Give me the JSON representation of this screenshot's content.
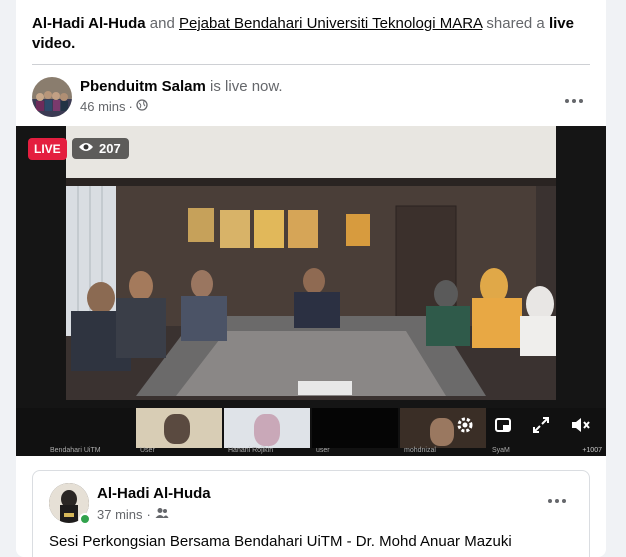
{
  "share": {
    "actor1": "Al-Hadi Al-Huda",
    "and": "and",
    "actor2": "Pejabat Bendahari Universiti Teknologi MARA",
    "shared_a": "shared a",
    "live": "live",
    "video": "video."
  },
  "post": {
    "author": "Pbenduitm Salam",
    "status": "is live now.",
    "time": "46 mins",
    "separator": "·"
  },
  "video": {
    "live_label": "LIVE",
    "viewers": "207",
    "thumb_labels": [
      "Bendahari UiTM",
      "User",
      "Hanani Rojikin",
      "user",
      "mohdnizal",
      "SyaM"
    ],
    "counter": "+1007"
  },
  "comment": {
    "author": "Al-Hadi Al-Huda",
    "time": "37 mins",
    "separator": "·",
    "text_prefix": "Sesi Perkongsian Bersama Bendahari UiTM - Dr. ",
    "text_name": "Mohd Anuar Mazuki"
  },
  "icons": {
    "globe": "globe-icon",
    "friends": "friends-icon",
    "eye": "eye-icon",
    "more": "more-icon"
  }
}
